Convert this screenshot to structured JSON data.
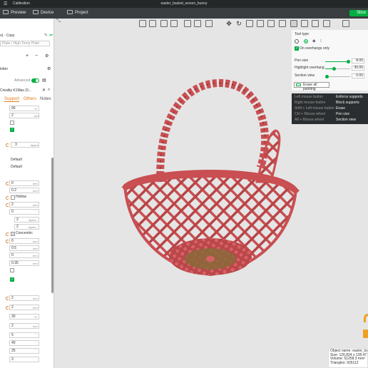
{
  "titlebar": {
    "calibration": "Calibration",
    "title": "easter_basket_woven_bunny"
  },
  "nav": {
    "preview": "Preview",
    "device": "Device",
    "project": "Project",
    "slice": "Slice"
  },
  "sidebar": {
    "profile_name": "o) - Copy",
    "plate_type": "Plate / High Temp Plate",
    "nozzle": "lotter",
    "advanced_label": "Advanced",
    "printer": "Creality K1Max (0...",
    "tabs": [
      "Support",
      "Others",
      "Notes"
    ],
    "values": {
      "v90": "90",
      "v2a": "2",
      "v3": "3",
      "layers": "layers",
      "default1": "Default",
      "default2": "Default",
      "v0a": "0",
      "v02": "0.2",
      "hollow": "Hollow",
      "v2b": "2",
      "v0b": "0",
      "v2c": "2",
      "v2d": "2",
      "concentric": "Concentric",
      "v0c": "0",
      "v05": "0.5",
      "v0d": "0",
      "v035": "0.35",
      "v2e": "2",
      "v2f": "2",
      "v30": "30",
      "v2g": "2",
      "v5": "5",
      "v40": "40",
      "v25": "25",
      "v3b": "3"
    },
    "units": {
      "mm": "mm",
      "pct": "%",
      "layers": "layers"
    }
  },
  "panel": {
    "tool_type": "Tool type",
    "on_overhangs": "On overhangs only",
    "pen_size_label": "Pen size",
    "pen_size_value": "8.00",
    "highlight_label": "Highlight overhang",
    "highlight_value": "30.00",
    "section_label": "Section view",
    "section_value": "0.00",
    "erase_all": "Erase all painting",
    "pen_size_fraction": 0.9,
    "highlight_fraction": 0.35,
    "section_fraction": 0.0
  },
  "hints": [
    {
      "key": "Left mouse button",
      "action": "Enforce supports"
    },
    {
      "key": "Right mouse button",
      "action": "Block supports"
    },
    {
      "key": "Shift + Left mouse button",
      "action": "Erase"
    },
    {
      "key": "Ctrl + Mouse wheel",
      "action": "Pen size"
    },
    {
      "key": "Alt + Mouse wheel",
      "action": "Section view"
    }
  ],
  "object_info": {
    "name": "Object name: easter_bask",
    "size": "Size: 126.824 x 128.471 x",
    "volume": "Volume: 51258.3 mm³",
    "triangles": "Triangles: 926112"
  },
  "colors": {
    "accent": "#00ae42",
    "model": "#c94f52",
    "warning": "#f0a020"
  }
}
